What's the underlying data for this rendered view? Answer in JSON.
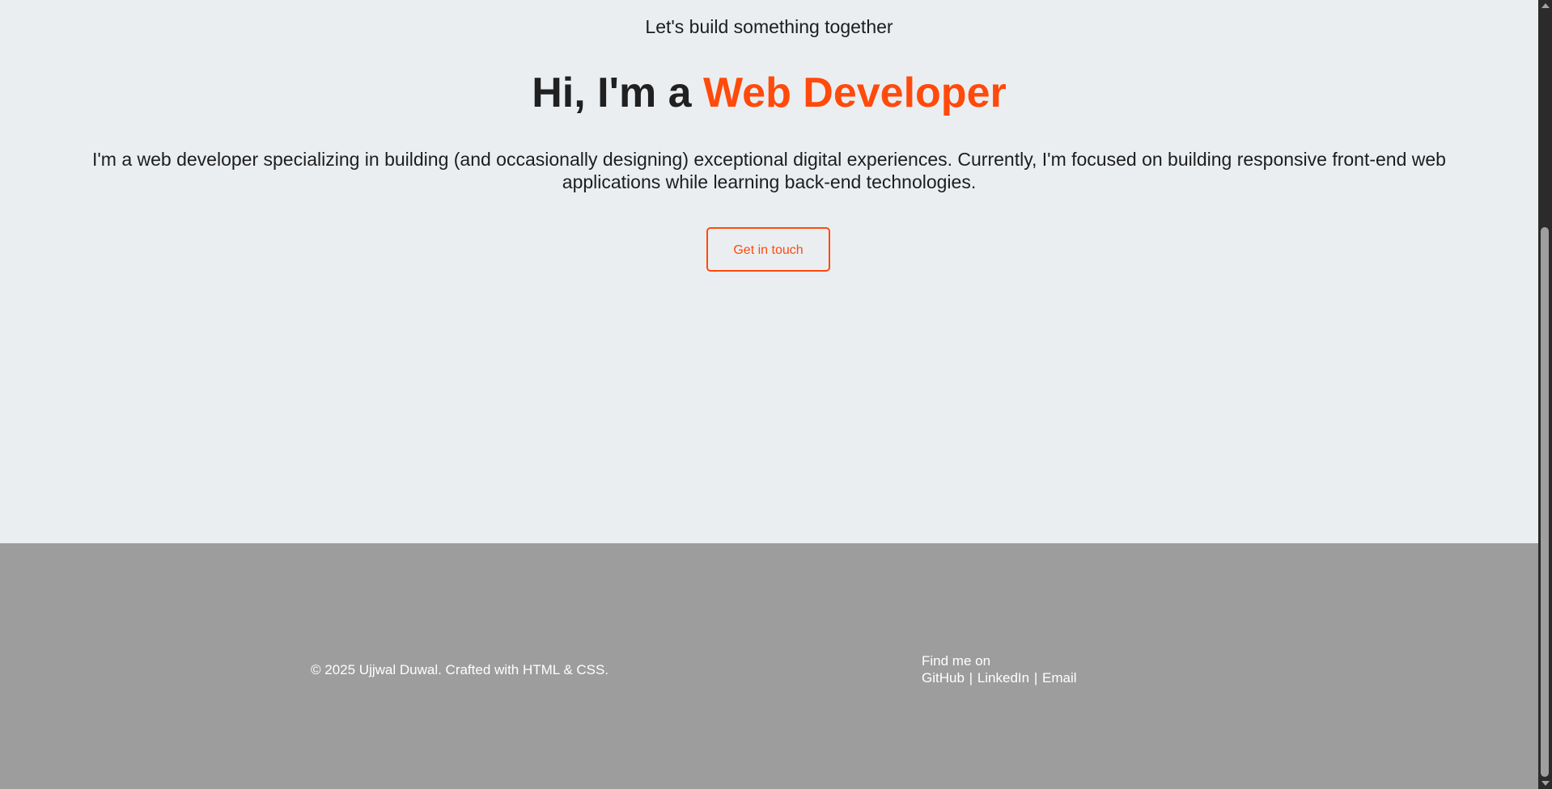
{
  "hero": {
    "tagline": "Let's build something together",
    "headline_prefix": "Hi, I'm a ",
    "headline_accent": "Web Developer",
    "intro": "I'm a web developer specializing in building (and occasionally designing) exceptional digital experiences. Currently, I'm focused on building responsive front-end web applications while learning back-end technologies.",
    "cta_label": "Get in touch"
  },
  "footer": {
    "copyright": "© 2025 Ujjwal Duwal. Crafted with HTML & CSS.",
    "social_heading": "Find me on",
    "links": [
      {
        "label": "GitHub"
      },
      {
        "label": "LinkedIn"
      },
      {
        "label": "Email"
      }
    ],
    "separator": "|"
  },
  "colors": {
    "accent": "#ff4a0b",
    "page_background": "#ebeef1",
    "footer_background": "#9d9d9d",
    "text": "#1d1d1d",
    "scrollbar_track": "#2b2b2b",
    "scrollbar_thumb": "#9f9f9f"
  }
}
